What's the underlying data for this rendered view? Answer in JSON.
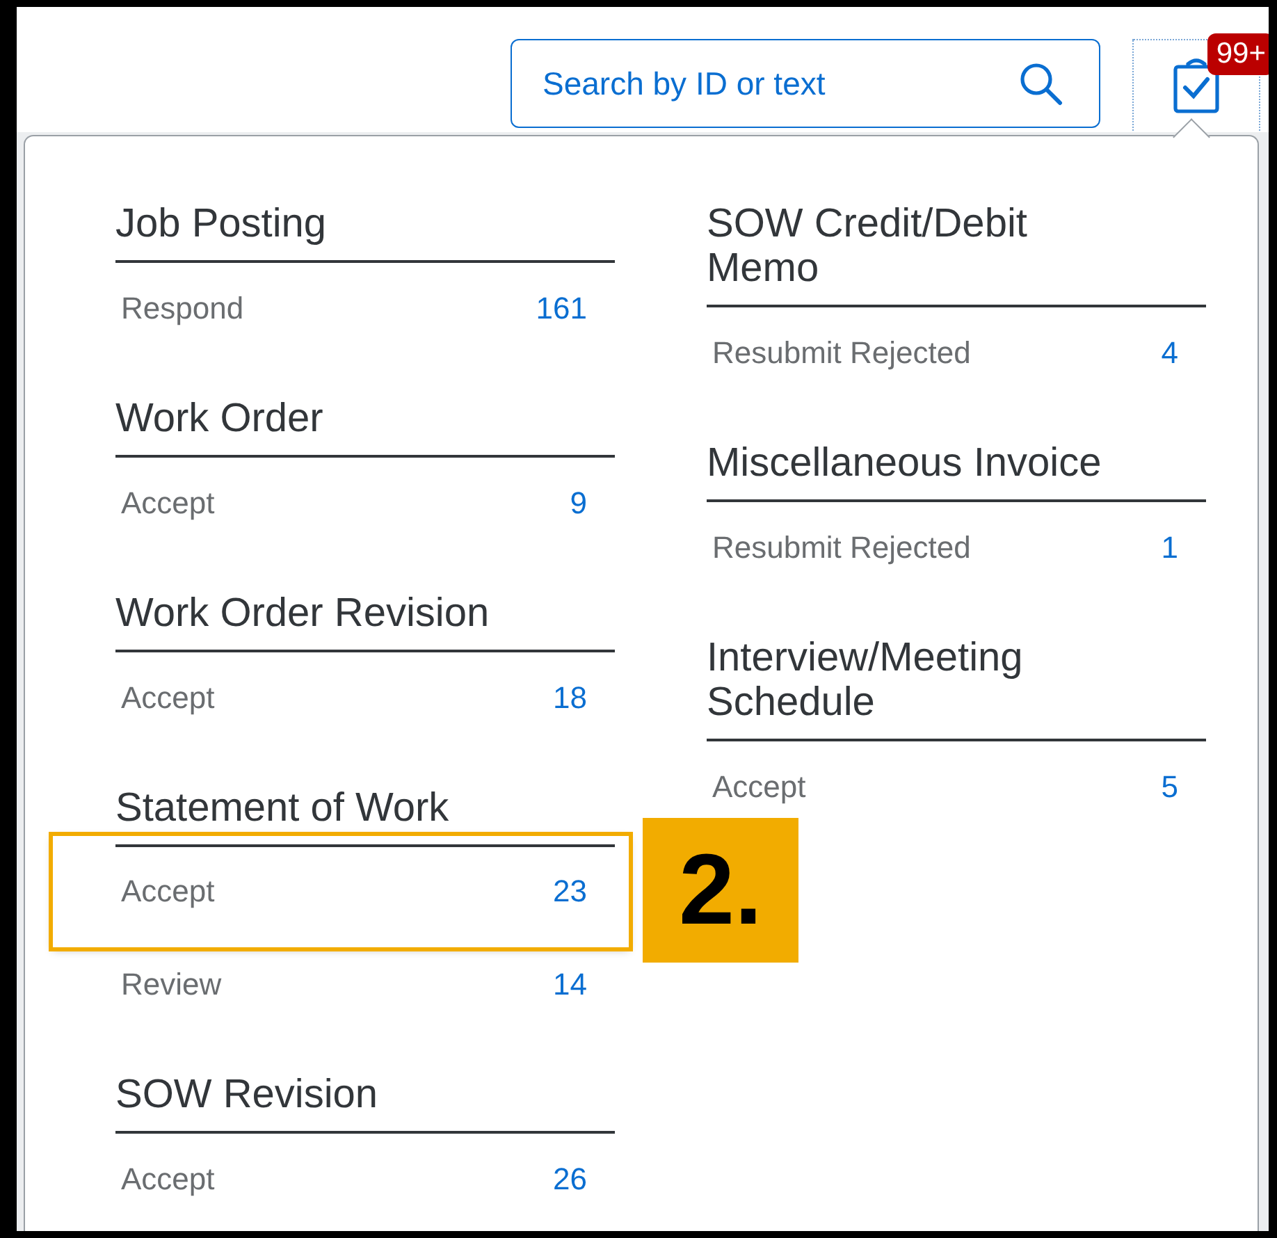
{
  "search": {
    "placeholder": "Search by ID or text"
  },
  "notifications": {
    "badge": "99+"
  },
  "columns": [
    [
      {
        "title": "Job Posting",
        "rows": [
          {
            "label": "Respond",
            "count": "161",
            "highlighted": false
          }
        ]
      },
      {
        "title": "Work Order",
        "rows": [
          {
            "label": "Accept",
            "count": "9",
            "highlighted": false
          }
        ]
      },
      {
        "title": "Work Order Revision",
        "rows": [
          {
            "label": "Accept",
            "count": "18",
            "highlighted": false
          }
        ]
      },
      {
        "title": "Statement of Work",
        "rows": [
          {
            "label": "Accept",
            "count": "23",
            "highlighted": true
          },
          {
            "label": "Review",
            "count": "14",
            "highlighted": false
          }
        ]
      },
      {
        "title": "SOW Revision",
        "rows": [
          {
            "label": "Accept",
            "count": "26",
            "highlighted": false
          }
        ]
      }
    ],
    [
      {
        "title": "SOW Credit/Debit Memo",
        "rows": [
          {
            "label": "Resubmit Rejected",
            "count": "4",
            "highlighted": false
          }
        ]
      },
      {
        "title": "Miscellaneous Invoice",
        "rows": [
          {
            "label": "Resubmit Rejected",
            "count": "1",
            "highlighted": false
          }
        ]
      },
      {
        "title": "Interview/Meeting Schedule",
        "rows": [
          {
            "label": "Accept",
            "count": "5",
            "highlighted": false
          }
        ]
      }
    ]
  ],
  "annotation": {
    "label": "2."
  }
}
